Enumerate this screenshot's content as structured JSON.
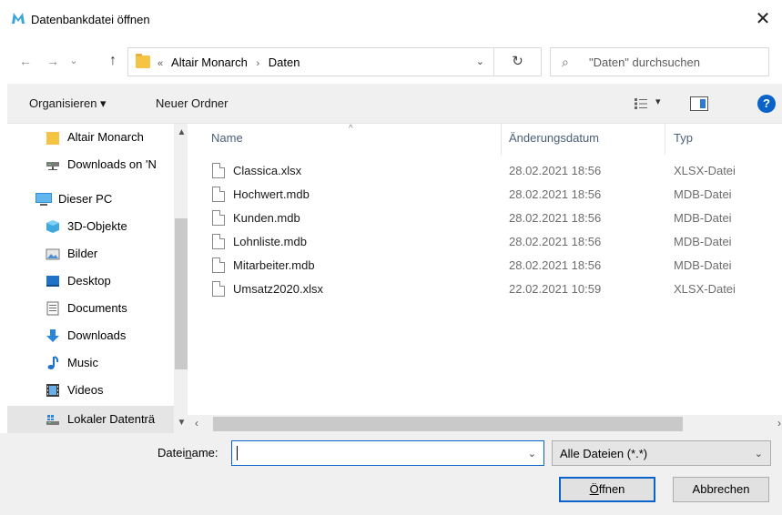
{
  "window": {
    "title": "Datenbankdatei öffnen",
    "close_glyph": "✕"
  },
  "icons": {
    "app": "monarch-logo-icon",
    "folder": "folder-icon",
    "file": "document-icon",
    "search": "search-icon",
    "refresh": "refresh-icon",
    "help": "help-icon"
  },
  "nav": {
    "back_glyph": "←",
    "forward_glyph": "→",
    "recent_glyph": "⌄",
    "up_glyph": "↑",
    "address": {
      "prefix": "«",
      "crumbs": [
        "Altair Monarch",
        "Daten"
      ],
      "separator": "›"
    },
    "refresh_glyph": "↻",
    "search_placeholder": "\"Daten\" durchsuchen"
  },
  "toolbar": {
    "organize_label": "Organisieren ▾",
    "new_folder_label": "Neuer Ordner",
    "help_glyph": "?"
  },
  "sidebar": {
    "items": [
      {
        "label": "Altair Monarch",
        "icon": "folder-icon"
      },
      {
        "label": "Downloads on 'N",
        "icon": "network-drive-icon"
      },
      {
        "label": "Dieser PC",
        "icon": "computer-icon"
      },
      {
        "label": "3D-Objekte",
        "icon": "3d-objects-icon"
      },
      {
        "label": "Bilder",
        "icon": "pictures-icon"
      },
      {
        "label": "Desktop",
        "icon": "desktop-icon"
      },
      {
        "label": "Documents",
        "icon": "documents-icon"
      },
      {
        "label": "Downloads",
        "icon": "downloads-icon"
      },
      {
        "label": "Music",
        "icon": "music-icon"
      },
      {
        "label": "Videos",
        "icon": "videos-icon"
      },
      {
        "label": "Lokaler Datenträ",
        "icon": "local-drive-icon"
      }
    ]
  },
  "columns": {
    "name": "Name",
    "date": "Änderungsdatum",
    "type": "Typ"
  },
  "files": [
    {
      "name": "Classica.xlsx",
      "date": "28.02.2021 18:56",
      "type": "XLSX-Datei"
    },
    {
      "name": "Hochwert.mdb",
      "date": "28.02.2021 18:56",
      "type": "MDB-Datei"
    },
    {
      "name": "Kunden.mdb",
      "date": "28.02.2021 18:56",
      "type": "MDB-Datei"
    },
    {
      "name": "Lohnliste.mdb",
      "date": "28.02.2021 18:56",
      "type": "MDB-Datei"
    },
    {
      "name": "Mitarbeiter.mdb",
      "date": "28.02.2021 18:56",
      "type": "MDB-Datei"
    },
    {
      "name": "Umsatz2020.xlsx",
      "date": "22.02.2021 10:59",
      "type": "XLSX-Datei"
    }
  ],
  "footer": {
    "filename_label_pre": "Datei",
    "filename_label_underline": "n",
    "filename_label_post": "ame:",
    "filename_value": "",
    "filter_value": "Alle Dateien (*.*)",
    "open_label_underline": "Ö",
    "open_label_rest": "ffnen",
    "cancel_label": "Abbrechen"
  },
  "colors": {
    "accent": "#0a63c9",
    "folder": "#f6c445",
    "chrome": "#f0f0f0"
  }
}
